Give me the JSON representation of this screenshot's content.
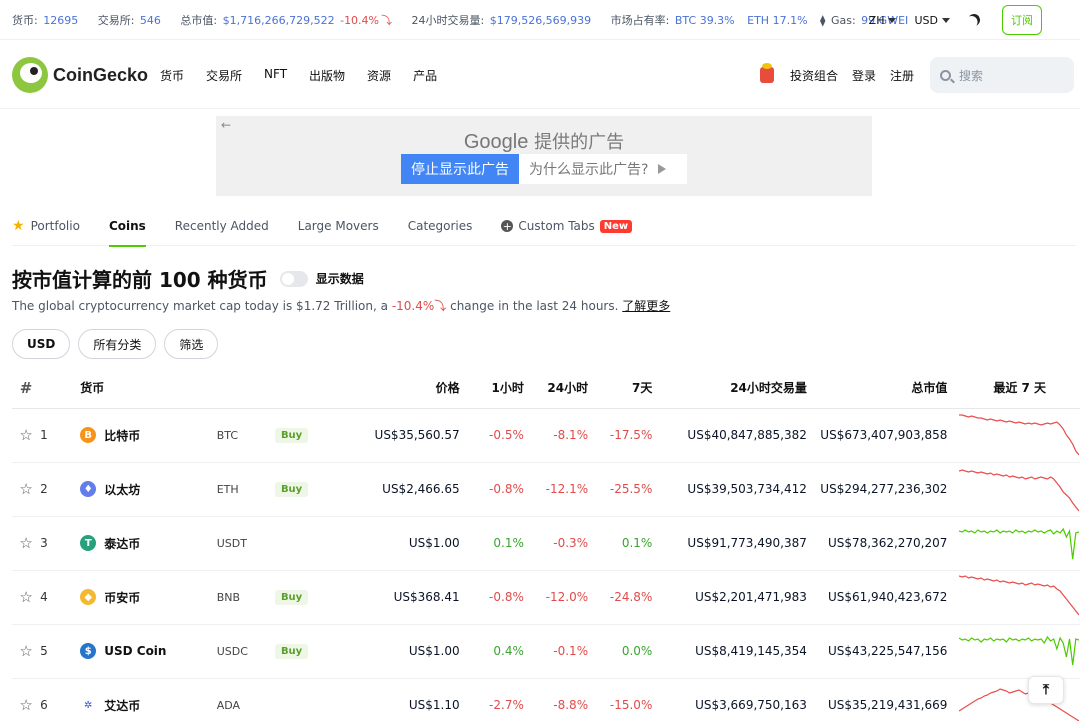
{
  "topbar": {
    "coins_label": "货币:",
    "coins_value": "12695",
    "exchanges_label": "交易所:",
    "exchanges_value": "546",
    "mcap_label": "总市值:",
    "mcap_value": "$1,716,266,729,522",
    "mcap_change": "-10.4%",
    "vol_label": "24小时交易量:",
    "vol_value": "$179,526,569,939",
    "dominance_label": "市场占有率:",
    "btc_dom": "BTC 39.3%",
    "eth_dom": "ETH 17.1%",
    "gas_label": "Gas:",
    "gas_value": "99 GWEI",
    "language": "ZH",
    "currency": "USD",
    "subscribe": "订阅"
  },
  "nav": {
    "brand": "CoinGecko",
    "menu": [
      "货币",
      "交易所",
      "NFT",
      "出版物",
      "资源",
      "产品"
    ],
    "portfolio": "投资组合",
    "login": "登录",
    "signup": "注册",
    "search_placeholder": "搜索"
  },
  "ad": {
    "title_brand": "Google",
    "title_rest": " 提供的广告",
    "stop": "停止显示此广告",
    "why": "为什么显示此广告?"
  },
  "tabs": {
    "portfolio": "Portfolio",
    "coins": "Coins",
    "recent": "Recently Added",
    "movers": "Large Movers",
    "categories": "Categories",
    "custom": "Custom Tabs",
    "new_badge": "New"
  },
  "main": {
    "title": "按市值计算的前 100 种货币",
    "toggle_label": "显示数据",
    "desc_prefix": "The global cryptocurrency market cap today is $1.72 Trillion, a ",
    "desc_change": "-10.4%",
    "desc_suffix": " change in the last 24 hours. ",
    "learn_more": "了解更多"
  },
  "filters": {
    "currency": "USD",
    "categories": "所有分类",
    "filter": "筛选"
  },
  "table": {
    "headers": {
      "rank": "#",
      "coin": "货币",
      "price": "价格",
      "h1": "1小时",
      "h24": "24小时",
      "d7": "7天",
      "volume": "24小时交易量",
      "mcap": "总市值",
      "spark": "最近 7 天"
    },
    "buy_label": "Buy",
    "rows": [
      {
        "rank": "1",
        "name": "比特币",
        "symbol": "BTC",
        "price": "US$35,560.57",
        "h1": "-0.5%",
        "h24": "-8.1%",
        "d7": "-17.5%",
        "volume": "US$40,847,885,382",
        "mcap": "US$673,407,903,858",
        "icon_color": "#f7931a",
        "icon_glyph": "B"
      },
      {
        "rank": "2",
        "name": "以太坊",
        "symbol": "ETH",
        "price": "US$2,466.65",
        "h1": "-0.8%",
        "h24": "-12.1%",
        "d7": "-25.5%",
        "volume": "US$39,503,734,412",
        "mcap": "US$294,277,236,302",
        "icon_color": "#627eea",
        "icon_glyph": "♦"
      },
      {
        "rank": "3",
        "name": "泰达币",
        "symbol": "USDT",
        "price": "US$1.00",
        "h1": "0.1%",
        "h24": "-0.3%",
        "d7": "0.1%",
        "volume": "US$91,773,490,387",
        "mcap": "US$78,362,270,207",
        "icon_color": "#26a17b",
        "icon_glyph": "T"
      },
      {
        "rank": "4",
        "name": "币安币",
        "symbol": "BNB",
        "price": "US$368.41",
        "h1": "-0.8%",
        "h24": "-12.0%",
        "d7": "-24.8%",
        "volume": "US$2,201,471,983",
        "mcap": "US$61,940,423,672",
        "icon_color": "#f3ba2f",
        "icon_glyph": "◆"
      },
      {
        "rank": "5",
        "name": "USD Coin",
        "symbol": "USDC",
        "price": "US$1.00",
        "h1": "0.4%",
        "h24": "-0.1%",
        "d7": "0.0%",
        "volume": "US$8,419,145,354",
        "mcap": "US$43,225,547,156",
        "icon_color": "#2775ca",
        "icon_glyph": "$"
      },
      {
        "rank": "6",
        "name": "艾达币",
        "symbol": "ADA",
        "price": "US$1.10",
        "h1": "-2.7%",
        "h24": "-8.8%",
        "d7": "-15.0%",
        "volume": "US$3,669,750,163",
        "mcap": "US$35,219,431,669",
        "icon_color": "#ffffff",
        "icon_glyph": "✲"
      }
    ]
  }
}
